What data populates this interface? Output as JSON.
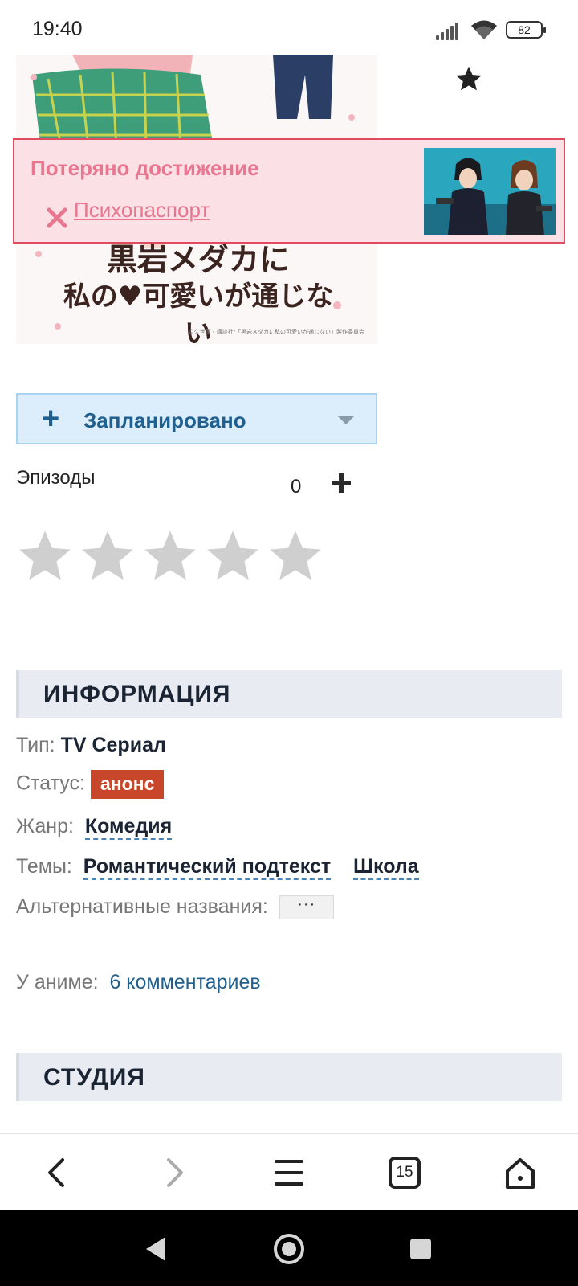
{
  "status_bar": {
    "time": "19:40",
    "battery": "82"
  },
  "poster": {
    "title_line1": "黒岩メダカに",
    "title_line2": "私の♥可愛いが通じない",
    "fine_print": "©久世蘭・講談社/「黒岩メダカに私の可愛いが通じない」製作委員会"
  },
  "achievement": {
    "title": "Потеряно достижение",
    "link_label": "Психопаспорт"
  },
  "list_status": {
    "plus": "+",
    "label": "Запланировано"
  },
  "episodes": {
    "label": "Эпизоды",
    "count": "0"
  },
  "rating": {
    "stars_total": 5,
    "stars_filled": 0
  },
  "info": {
    "heading": "ИНФОРМАЦИЯ",
    "type_label": "Тип:",
    "type_value": "TV Сериал",
    "status_label": "Статус:",
    "status_value": "анонс",
    "genre_label": "Жанр:",
    "genre_value": "Комедия",
    "themes_label": "Темы:",
    "themes": [
      "Романтический подтекст",
      "Школа"
    ],
    "alt_names_label": "Альтернативные названия:",
    "alt_names_button": "···",
    "comments_label": "У аниме:",
    "comments_link": "6 комментариев"
  },
  "studio": {
    "heading": "СТУДИЯ"
  },
  "browser_toolbar": {
    "tabs_count": "15"
  },
  "colors": {
    "accent": "#20608f",
    "status_badge": "#c8472a",
    "achievement_bg": "#fbe0e6",
    "achievement_border": "#e14b5f",
    "achievement_text": "#e8768f"
  }
}
